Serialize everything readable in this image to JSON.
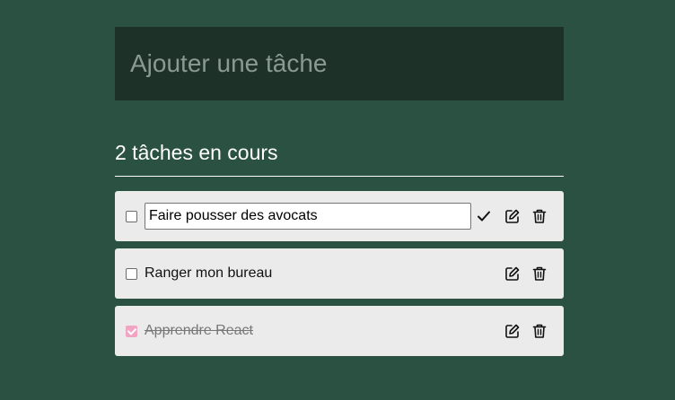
{
  "new_task": {
    "placeholder": "Ajouter une tâche"
  },
  "summary": {
    "count_text": "2 tâches en cours"
  },
  "tasks": [
    {
      "label": "Faire pousser des avocats",
      "completed": false,
      "editing": true
    },
    {
      "label": "Ranger mon bureau",
      "completed": false,
      "editing": false
    },
    {
      "label": "Apprendre React",
      "completed": true,
      "editing": false
    }
  ],
  "icons": {
    "confirm": "check-icon",
    "edit": "pencil-square-icon",
    "delete": "trash-icon"
  },
  "colors": {
    "background": "#2b5143",
    "input_background": "#1e3129",
    "item_background": "#ebebeb",
    "checked_accent": "#f0a6c3"
  }
}
